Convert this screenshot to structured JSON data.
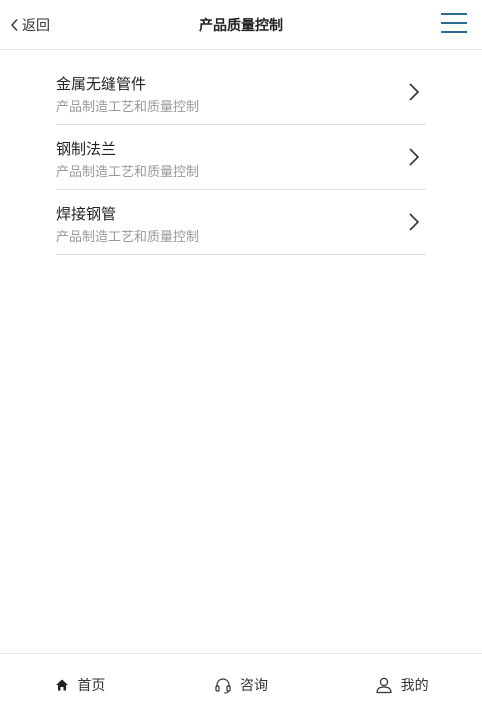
{
  "header": {
    "back_label": "返回",
    "title": "产品质量控制",
    "menu_icon": "hamburger-menu-icon",
    "menu_color": "#2d6a8f"
  },
  "list": {
    "items": [
      {
        "title": "金属无缝管件",
        "subtitle": "产品制造工艺和质量控制"
      },
      {
        "title": "钢制法兰",
        "subtitle": "产品制造工艺和质量控制"
      },
      {
        "title": "焊接钢管",
        "subtitle": "产品制造工艺和质量控制"
      }
    ]
  },
  "tabbar": {
    "tabs": [
      {
        "label": "首页",
        "icon": "home-icon"
      },
      {
        "label": "咨询",
        "icon": "headset-icon"
      },
      {
        "label": "我的",
        "icon": "user-icon"
      }
    ]
  }
}
